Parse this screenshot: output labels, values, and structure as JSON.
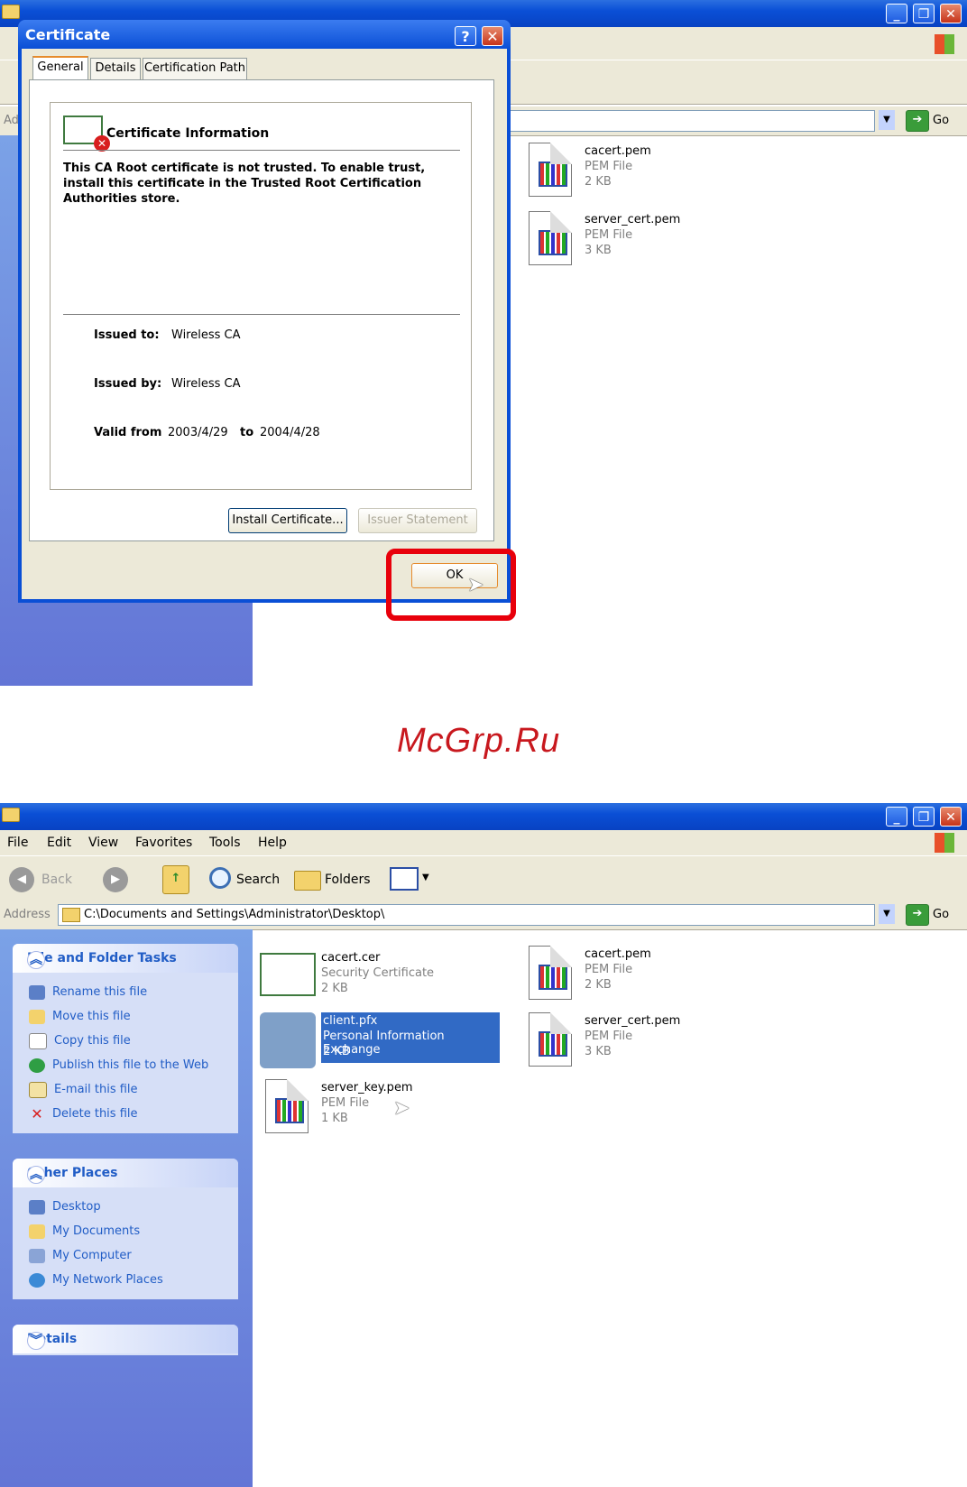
{
  "top_explorer": {
    "address_label": "Ad",
    "go_label": "Go",
    "files": [
      {
        "name": "cacert.pem",
        "type": "PEM File",
        "size": "2 KB"
      },
      {
        "name": "server_cert.pem",
        "type": "PEM File",
        "size": "3 KB"
      }
    ]
  },
  "dialog": {
    "title": "Certificate",
    "help_button": "?",
    "close_button": "✕",
    "tabs": [
      "General",
      "Details",
      "Certification Path"
    ],
    "info_heading": "Certificate Information",
    "warning_text": "This CA Root certificate is not trusted. To enable trust, install this certificate in the Trusted Root Certification Authorities store.",
    "issued_to_label": "Issued to:",
    "issued_to_value": "Wireless CA",
    "issued_by_label": "Issued by:",
    "issued_by_value": "Wireless CA",
    "valid_from_label": "Valid from",
    "valid_from_value": "2003/4/29",
    "valid_to_label": "to",
    "valid_to_value": "2004/4/28",
    "install_button": "Install Certificate...",
    "issuer_statement_button": "Issuer Statement",
    "ok_button": "OK",
    "highlight_color": "#e8000b"
  },
  "watermark": "McGrp.Ru",
  "bottom_explorer": {
    "menu": [
      "File",
      "Edit",
      "View",
      "Favorites",
      "Tools",
      "Help"
    ],
    "toolbar": {
      "back": "Back",
      "search": "Search",
      "folders": "Folders"
    },
    "address_label": "Address",
    "address_value": "C:\\Documents and Settings\\Administrator\\Desktop\\",
    "go_label": "Go",
    "file_tasks": {
      "title": "File and Folder Tasks",
      "items": [
        "Rename this file",
        "Move this file",
        "Copy this file",
        "Publish this file to the Web",
        "E-mail this file",
        "Delete this file"
      ]
    },
    "other_places": {
      "title": "Other Places",
      "items": [
        "Desktop",
        "My Documents",
        "My Computer",
        "My Network Places"
      ]
    },
    "details": {
      "title": "Details"
    },
    "files": [
      {
        "name": "cacert.cer",
        "type": "Security Certificate",
        "size": "2 KB"
      },
      {
        "name": "cacert.pem",
        "type": "PEM File",
        "size": "2 KB"
      },
      {
        "name": "client.pfx",
        "type": "Personal Information Exchange",
        "size": "2 KB"
      },
      {
        "name": "server_cert.pem",
        "type": "PEM File",
        "size": "3 KB"
      },
      {
        "name": "server_key.pem",
        "type": "PEM File",
        "size": "1 KB"
      }
    ]
  }
}
